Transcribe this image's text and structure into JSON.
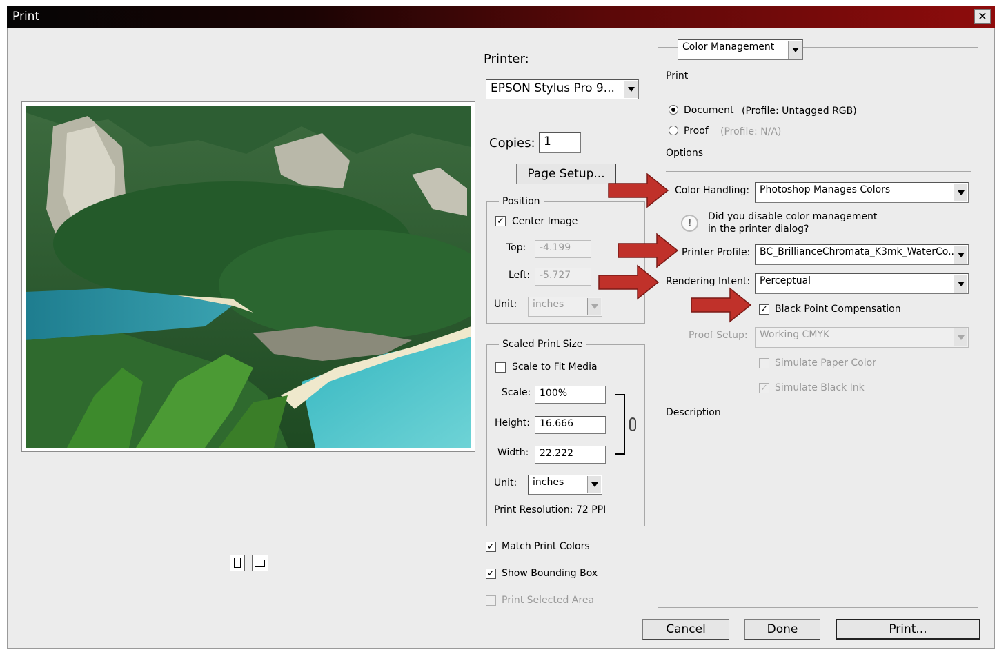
{
  "window": {
    "title": "Print"
  },
  "printer": {
    "label": "Printer:",
    "value": "EPSON Stylus Pro 9...",
    "copies_label": "Copies:",
    "copies_value": "1",
    "page_setup_label": "Page Setup..."
  },
  "position": {
    "legend": "Position",
    "center_image_label": "Center Image",
    "center_image_checked": true,
    "top_label": "Top:",
    "top_value": "-4.199",
    "left_label": "Left:",
    "left_value": "-5.727",
    "unit_label": "Unit:",
    "unit_value": "inches"
  },
  "scaled_print_size": {
    "legend": "Scaled Print Size",
    "scale_to_fit_label": "Scale to Fit Media",
    "scale_to_fit_checked": false,
    "scale_label": "Scale:",
    "scale_value": "100%",
    "height_label": "Height:",
    "height_value": "16.666",
    "width_label": "Width:",
    "width_value": "22.222",
    "unit_label": "Unit:",
    "unit_value": "inches",
    "resolution_text": "Print Resolution: 72 PPI"
  },
  "options_bottom": {
    "match_print_colors_label": "Match Print Colors",
    "match_print_colors_checked": true,
    "show_bounding_box_label": "Show Bounding Box",
    "show_bounding_box_checked": true,
    "print_selected_area_label": "Print Selected Area",
    "print_selected_area_checked": false
  },
  "color_management": {
    "section_select": "Color Management",
    "print_heading": "Print",
    "document_label": "Document",
    "document_profile": "(Profile: Untagged RGB)",
    "document_selected": true,
    "proof_label": "Proof",
    "proof_profile": "(Profile: N/A)",
    "options_heading": "Options",
    "color_handling_label": "Color Handling:",
    "color_handling_value": "Photoshop Manages Colors",
    "warning_line1": "Did you disable color management",
    "warning_line2": "in the printer dialog?",
    "printer_profile_label": "Printer Profile:",
    "printer_profile_value": "BC_BrillianceChromata_K3mk_WaterCo...",
    "rendering_intent_label": "Rendering Intent:",
    "rendering_intent_value": "Perceptual",
    "black_point_label": "Black Point Compensation",
    "black_point_checked": true,
    "proof_setup_label": "Proof Setup:",
    "proof_setup_value": "Working CMYK",
    "simulate_paper_label": "Simulate Paper Color",
    "simulate_black_label": "Simulate Black Ink",
    "description_heading": "Description"
  },
  "footer": {
    "cancel_label": "Cancel",
    "done_label": "Done",
    "print_label": "Print..."
  },
  "icons": [
    "close-icon",
    "portrait-orientation-icon",
    "landscape-orientation-icon",
    "link-chain-icon",
    "warning-icon",
    "red-arrow-icon"
  ],
  "colors": {
    "annotation_arrow": "#c0312a",
    "title_bar_end": "#8e0c0c"
  }
}
